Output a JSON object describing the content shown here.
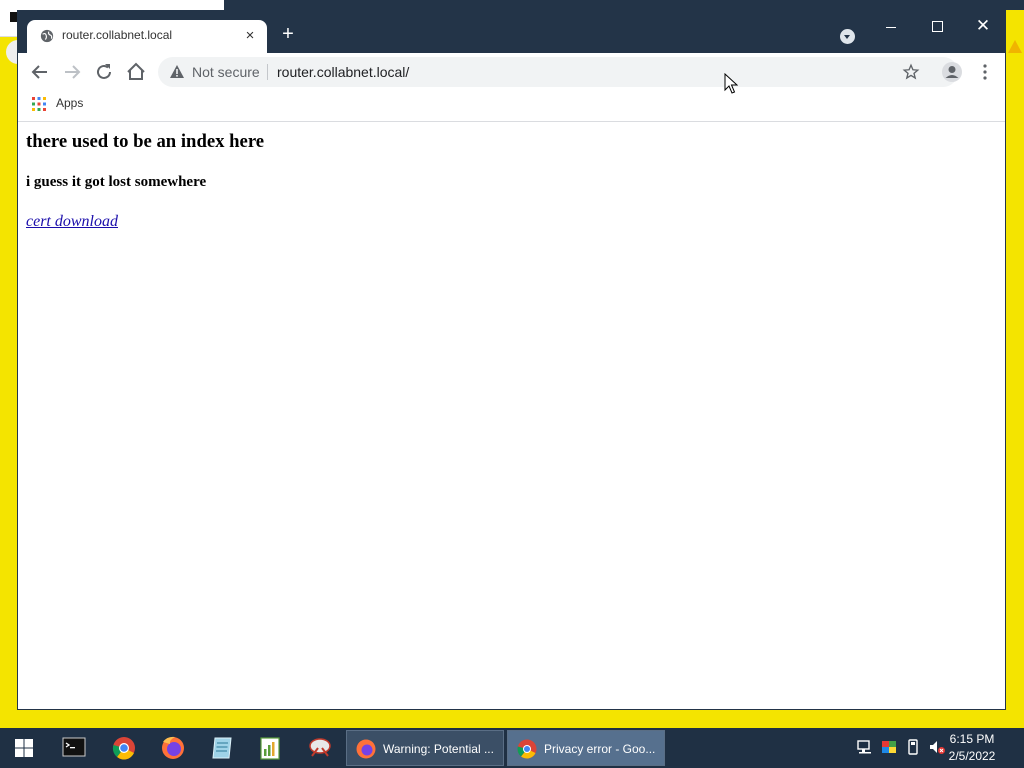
{
  "browser": {
    "tab": {
      "title": "router.collabnet.local",
      "close": "×"
    },
    "new_tab": "+",
    "window_close": "✕",
    "omnibox": {
      "security_label": "Not secure",
      "url": "router.collabnet.local/"
    },
    "bookmarks": {
      "apps_label": "Apps"
    }
  },
  "page": {
    "heading": "there used to be an index here",
    "subheading": "i guess it got lost somewhere",
    "link_text": "cert download"
  },
  "taskbar": {
    "apps": [
      {
        "label": "Warning: Potential ..."
      },
      {
        "label": "Privacy error - Goo..."
      }
    ],
    "clock": {
      "time": "6:15 PM",
      "date": "2/5/2022"
    }
  },
  "colors": {
    "desktop": "#f4e400",
    "titlebar": "#233448",
    "taskbar": "#1f3044",
    "link": "#1a0dab"
  }
}
